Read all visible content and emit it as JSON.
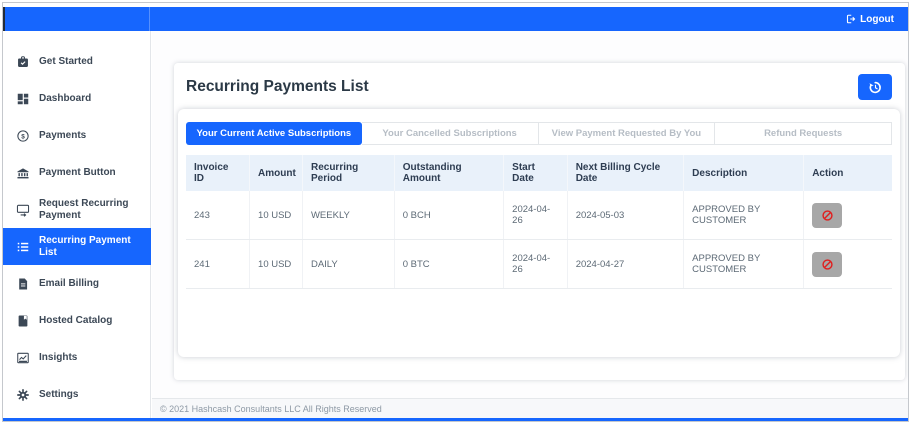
{
  "colors": {
    "accent_blue": "#1666fe",
    "table_header_bg": "#e9f1fa",
    "cancel_icon_red": "#e01e1e",
    "action_button_gray": "#a7a7a7"
  },
  "topbar": {
    "logout_label": "Logout"
  },
  "sidebar": {
    "active_item": "Recurring Payment List",
    "items": [
      {
        "label": "Get Started",
        "icon": "briefcase-check-icon"
      },
      {
        "label": "Dashboard",
        "icon": "dashboard-grid-icon"
      },
      {
        "label": "Payments",
        "icon": "dollar-circle-icon"
      },
      {
        "label": "Payment Button",
        "icon": "bank-icon"
      },
      {
        "label": "Request Recurring Payment",
        "icon": "card-arrow-icon"
      },
      {
        "label": "Recurring Payment List",
        "icon": "list-icon"
      },
      {
        "label": "Email Billing",
        "icon": "document-icon"
      },
      {
        "label": "Hosted Catalog",
        "icon": "book-icon"
      },
      {
        "label": "Insights",
        "icon": "chart-icon"
      },
      {
        "label": "Settings",
        "icon": "gear-icon"
      }
    ]
  },
  "main": {
    "title": "Recurring Payments List",
    "history_button_icon": "history-icon",
    "active_tab_index": 0,
    "tabs": [
      "Your Current Active Subscriptions",
      "Your Cancelled Subscriptions",
      "View Payment Requested By You",
      "Refund Requests"
    ],
    "table": {
      "columns": [
        "Invoice ID",
        "Amount",
        "Recurring Period",
        "Outstanding Amount",
        "Start Date",
        "Next Billing Cycle Date",
        "Description",
        "Action"
      ],
      "rows": [
        [
          "243",
          "10 USD",
          "WEEKLY",
          "0 BCH",
          "2024-04-26",
          "2024-05-03",
          "APPROVED BY CUSTOMER"
        ],
        [
          "241",
          "10 USD",
          "DAILY",
          "0 BTC",
          "2024-04-26",
          "2024-04-27",
          "APPROVED BY CUSTOMER"
        ]
      ]
    }
  },
  "footer": {
    "copyright": "© 2021 Hashcash Consultants LLC All Rights Reserved"
  }
}
